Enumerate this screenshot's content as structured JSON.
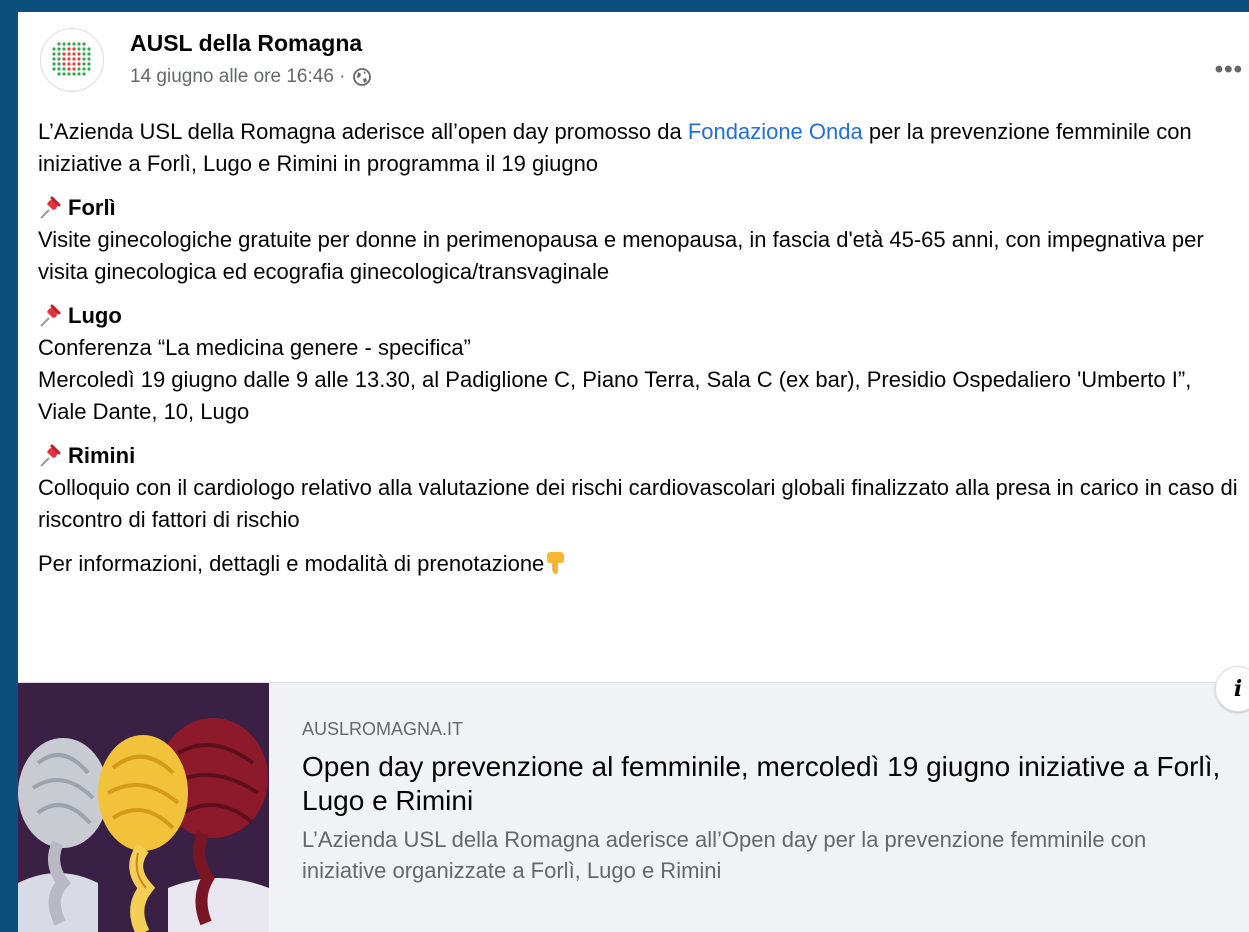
{
  "post": {
    "author": "AUSL della Romagna",
    "timestamp": "14 giugno alle ore 16:46 ·",
    "more_label": "•••",
    "intro_pre": "L’Azienda USL della Romagna aderisce all’open day promosso da ",
    "intro_link": "Fondazione Onda",
    "intro_post": "  per la prevenzione femminile con iniziative a Forlì, Lugo e Rimini in programma il 19 giugno",
    "sections": [
      {
        "title": "Forlì",
        "lines": [
          "Visite ginecologiche gratuite per donne in perimenopausa e menopausa, in fascia d'età 45-65 anni, con impegnativa per visita ginecologica ed ecografia ginecologica/transvaginale"
        ]
      },
      {
        "title": "Lugo",
        "lines": [
          "Conferenza “La medicina genere - specifica”",
          "Mercoledì 19 giugno dalle 9 alle 13.30, al Padiglione C, Piano Terra, Sala C (ex bar), Presidio Ospedaliero 'Umberto I”, Viale Dante, 10, Lugo"
        ]
      },
      {
        "title": "Rimini",
        "lines": [
          "Colloquio con il cardiologo relativo alla valutazione dei rischi cardiovascolari globali finalizzato alla presa in carico in caso di riscontro di fattori di rischio"
        ]
      },
      {
        "title": "",
        "lines": []
      }
    ],
    "closing": "Per informazioni, dettagli e modalità di prenotazione"
  },
  "link_preview": {
    "domain": "AUSLROMAGNA.IT",
    "title": "Open day prevenzione al femminile, mercoledì 19 giugno iniziative a Forlì, Lugo e Rimini",
    "description": "L’Azienda USL della Romagna aderisce all’Open day per la prevenzione femminile con iniziative organizzate a Forlì, Lugo e Rimini",
    "info_label": "i"
  },
  "icons": {
    "pin": "pushpin-icon",
    "point_down": "backhand-index-pointing-down-icon",
    "globe": "globe-icon",
    "info": "info-icon"
  },
  "colors": {
    "background": "#0b4f7c",
    "link": "#216fdb",
    "secondary_text": "#65676b",
    "preview_bg": "#f0f2f5"
  }
}
